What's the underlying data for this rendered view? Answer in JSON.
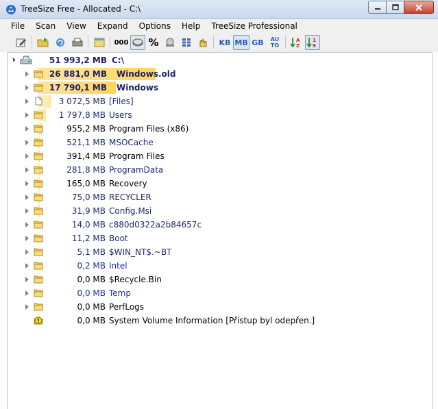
{
  "window": {
    "title": "TreeSize Free - Allocated - C:\\"
  },
  "menu": [
    "File",
    "Scan",
    "View",
    "Expand",
    "Options",
    "Help",
    "TreeSize Professional"
  ],
  "toolbar": {
    "unit_kb": "KB",
    "unit_mb": "MB",
    "unit_gb": "GB",
    "unit_auto_top": "AU",
    "unit_auto_bottom": "TO",
    "percent": "%",
    "count_label": "000",
    "selected_unit": "MB"
  },
  "root": {
    "size": "51 993,2 MB",
    "name": "C:\\"
  },
  "rows": [
    {
      "size": "26 881,0 MB",
      "name": "Windows.old",
      "pct": 51.7,
      "bold": true,
      "icon": "folder-icon"
    },
    {
      "size": "17 790,1 MB",
      "name": "Windows",
      "pct": 34.2,
      "bold": true,
      "icon": "folder-icon"
    },
    {
      "size": "3 072,5 MB",
      "name": "[Files]",
      "pct": 5.9,
      "icon": "file-icon"
    },
    {
      "size": "1 797,8 MB",
      "name": "Users",
      "pct": 3.5,
      "icon": "folder-icon"
    },
    {
      "size": "955,2 MB",
      "name": "Program Files (x86)",
      "pct": 1.8,
      "icon": "folder-icon"
    },
    {
      "size": "521,1 MB",
      "name": "MSOCache",
      "pct": 1.0,
      "icon": "folder-icon"
    },
    {
      "size": "391,4 MB",
      "name": "Program Files",
      "pct": 0.8,
      "icon": "folder-icon"
    },
    {
      "size": "281,8 MB",
      "name": "ProgramData",
      "pct": 0.5,
      "icon": "folder-icon"
    },
    {
      "size": "165,0 MB",
      "name": "Recovery",
      "pct": 0.3,
      "icon": "folder-icon"
    },
    {
      "size": "75,0 MB",
      "name": "RECYCLER",
      "pct": 0.1,
      "icon": "folder-icon"
    },
    {
      "size": "31,9 MB",
      "name": "Config.Msi",
      "pct": 0.1,
      "icon": "folder-icon"
    },
    {
      "size": "14,0 MB",
      "name": "c880d0322a2b84657c",
      "pct": 0,
      "icon": "folder-icon"
    },
    {
      "size": "11,2 MB",
      "name": "Boot",
      "pct": 0,
      "icon": "folder-icon"
    },
    {
      "size": "5,1 MB",
      "name": "$WIN_NT$.~BT",
      "pct": 0,
      "icon": "folder-icon"
    },
    {
      "size": "0,2 MB",
      "name": "Intel",
      "pct": 0,
      "icon": "folder-icon"
    },
    {
      "size": "0,0 MB",
      "name": "$Recycle.Bin",
      "pct": 0,
      "icon": "folder-icon"
    },
    {
      "size": "0,0 MB",
      "name": "Temp",
      "pct": 0,
      "icon": "folder-icon"
    },
    {
      "size": "0,0 MB",
      "name": "PerfLogs",
      "pct": 0,
      "icon": "folder-icon"
    },
    {
      "size": "0,0 MB",
      "name": "System Volume Information  [Přístup byl odepřen.]",
      "pct": 0,
      "icon": "warning-icon"
    }
  ]
}
